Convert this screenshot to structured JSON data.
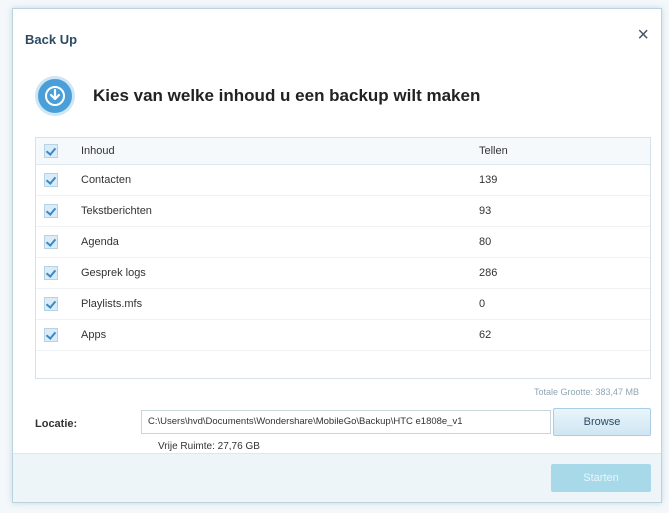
{
  "dialog": {
    "title": "Back Up",
    "close_glyph": "×",
    "heading": "Kies van welke inhoud u een backup wilt maken",
    "icon": "download-circle-icon"
  },
  "table": {
    "headers": {
      "name": "Inhoud",
      "count": "Tellen"
    },
    "rows": [
      {
        "name": "Contacten",
        "count": "139",
        "checked": true
      },
      {
        "name": "Tekstberichten",
        "count": "93",
        "checked": true
      },
      {
        "name": "Agenda",
        "count": "80",
        "checked": true
      },
      {
        "name": "Gesprek logs",
        "count": "286",
        "checked": true
      },
      {
        "name": "Playlists.mfs",
        "count": "0",
        "checked": true
      },
      {
        "name": "Apps",
        "count": "62",
        "checked": true
      }
    ],
    "total": "Totale Grootte: 383,47 MB"
  },
  "location": {
    "label": "Locatie:",
    "path": "C:\\Users\\hvd\\Documents\\Wondershare\\MobileGo\\Backup\\HTC e1808e_v1",
    "browse_label": "Browse",
    "free_space": "Vrije Ruimte: 27,76 GB"
  },
  "footer": {
    "start_label": "Starten"
  },
  "colors": {
    "accent": "#4a9fd8",
    "start_button": "#a8d9e8"
  }
}
